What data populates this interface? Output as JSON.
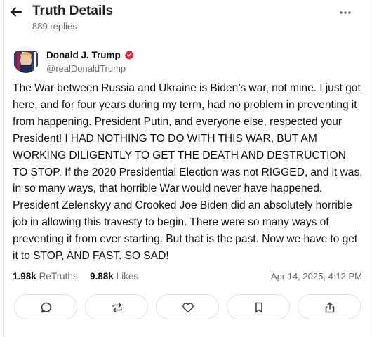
{
  "header": {
    "title": "Truth Details",
    "replies": "889 replies",
    "back_icon": "arrow-left-icon",
    "more_icon": "ellipsis-icon"
  },
  "author": {
    "name": "Donald J. Trump",
    "handle": "@realDonaldTrump",
    "verified_color": "#e3223a"
  },
  "post": {
    "text": "The War between Russia and Ukraine is Biden’s war, not mine. I just got here, and for four years during my term, had no problem in preventing it from happening. President Putin, and everyone else, respected your President! I HAD NOTHING TO DO WITH THIS WAR, BUT AM WORKING DILIGENTLY TO GET THE DEATH AND DESTRUCTION TO STOP. If the 2020 Presidential Election was not RIGGED, and it was, in so many ways, that horrible War would never have happened. President Zelenskyy and Crooked Joe Biden did an absolutely horrible job in allowing this travesty to begin. There were so many ways of preventing it from ever starting. But that is the past. Now we have to get it to STOP, AND FAST. SO SAD!"
  },
  "stats": {
    "retruths_count": "1.98k",
    "retruths_label": "ReTruths",
    "likes_count": "9.88k",
    "likes_label": "Likes",
    "timestamp": "Apr 14, 2025, 4:12 PM"
  },
  "actions": {
    "icons": [
      "comment-icon",
      "retruth-icon",
      "heart-icon",
      "bookmark-icon",
      "share-icon"
    ]
  },
  "colors": {
    "text": "#111111",
    "muted": "#6b6b6f",
    "border": "#e1e1e6",
    "verified": "#e3223a"
  }
}
